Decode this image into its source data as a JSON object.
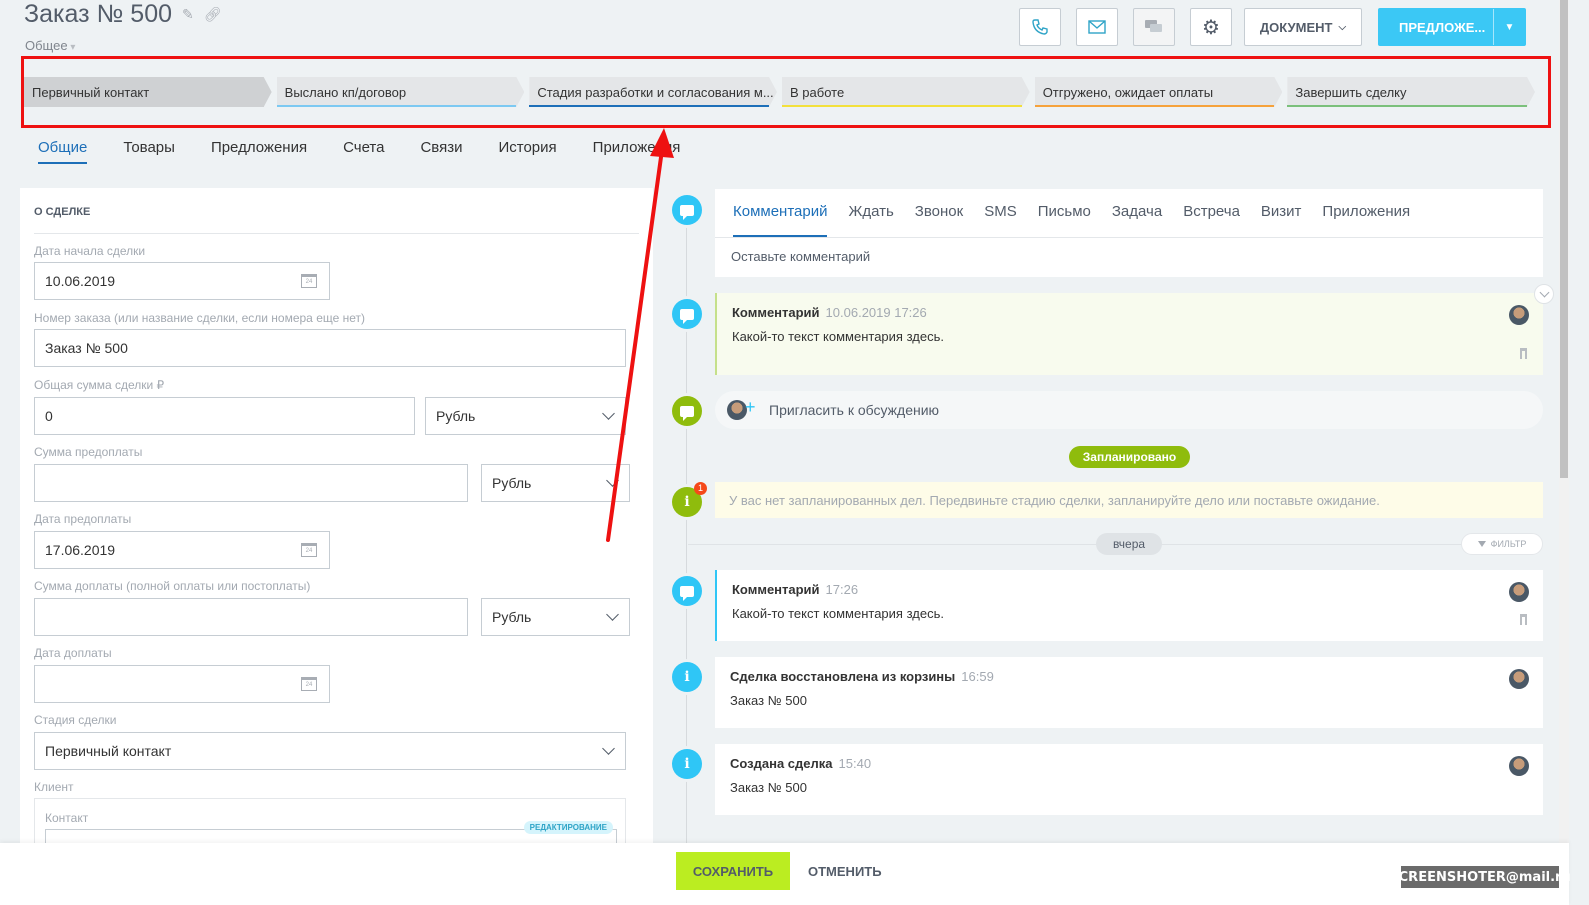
{
  "header": {
    "title": "Заказ № 500",
    "subtitle": "Общее",
    "document_label": "ДОКУМЕНТ",
    "offer_label": "ПРЕДЛОЖЕ..."
  },
  "stages": [
    {
      "label": "Первичный контакт",
      "color": "#cfd1d3"
    },
    {
      "label": "Выслано кп/договор",
      "color": "#7cc9f2"
    },
    {
      "label": "Стадия разработки и согласования м...",
      "color": "#1d6fb8"
    },
    {
      "label": "В работе",
      "color": "#f3e03b"
    },
    {
      "label": "Отгружено, ожидает оплаты",
      "color": "#f6a23b"
    },
    {
      "label": "Завершить сделку",
      "color": "#7bc07b"
    }
  ],
  "tabs": [
    "Общие",
    "Товары",
    "Предложения",
    "Счета",
    "Связи",
    "История",
    "Приложения"
  ],
  "deal": {
    "section_title": "О СДЕЛКЕ",
    "start_date_label": "Дата начала сделки",
    "start_date": "10.06.2019",
    "order_label": "Номер заказа (или название сделки, если номера еще нет)",
    "order_value": "Заказ № 500",
    "sum_label": "Общая сумма сделки ₽",
    "sum_value": "0",
    "currency": "Рубль",
    "prepay_label": "Сумма предоплаты",
    "prepay_date_label": "Дата предоплаты",
    "prepay_date": "17.06.2019",
    "surcharge_label": "Сумма доплаты (полной оплаты или постоплаты)",
    "surcharge_date_label": "Дата доплаты",
    "stage_label": "Стадия сделки",
    "stage_value": "Первичный контакт",
    "client_label": "Клиент",
    "contact_label": "Контакт",
    "edit_badge": "РЕДАКТИРОВАНИЕ",
    "cal_num": "24"
  },
  "timeline": {
    "composer_tabs": [
      "Комментарий",
      "Ждать",
      "Звонок",
      "SMS",
      "Письмо",
      "Задача",
      "Встреча",
      "Визит",
      "Приложения"
    ],
    "composer_placeholder": "Оставьте комментарий",
    "pinned": {
      "title": "Комментарий",
      "time": "10.06.2019 17:26",
      "text": "Какой-то текст комментария здесь."
    },
    "invite_text": "Пригласить к обсуждению",
    "planned_label": "Запланировано",
    "no_plans": "У вас нет запланированных дел. Передвиньте стадию сделки, запланируйте дело или поставьте ожидание.",
    "notif_count": "1",
    "yesterday_label": "вчера",
    "filter_label": "ФИЛЬТР",
    "events": [
      {
        "title": "Комментарий",
        "time": "17:26",
        "text": "Какой-то текст комментария здесь."
      },
      {
        "title": "Сделка восстановлена из корзины",
        "time": "16:59",
        "text": "Заказ № 500"
      },
      {
        "title": "Создана сделка",
        "time": "15:40",
        "text": "Заказ № 500"
      }
    ]
  },
  "footer": {
    "save_label": "СОХРАНИТЬ",
    "cancel_label": "ОТМЕНИТЬ",
    "watermark": "SCREENSHOTER@mail.ru"
  },
  "colors": {
    "accent": "#3bc8f5",
    "save": "#bbed21",
    "annotation": "#ee1111",
    "timeline_blue": "#2fc6f6",
    "timeline_green": "#8fbc0c"
  }
}
